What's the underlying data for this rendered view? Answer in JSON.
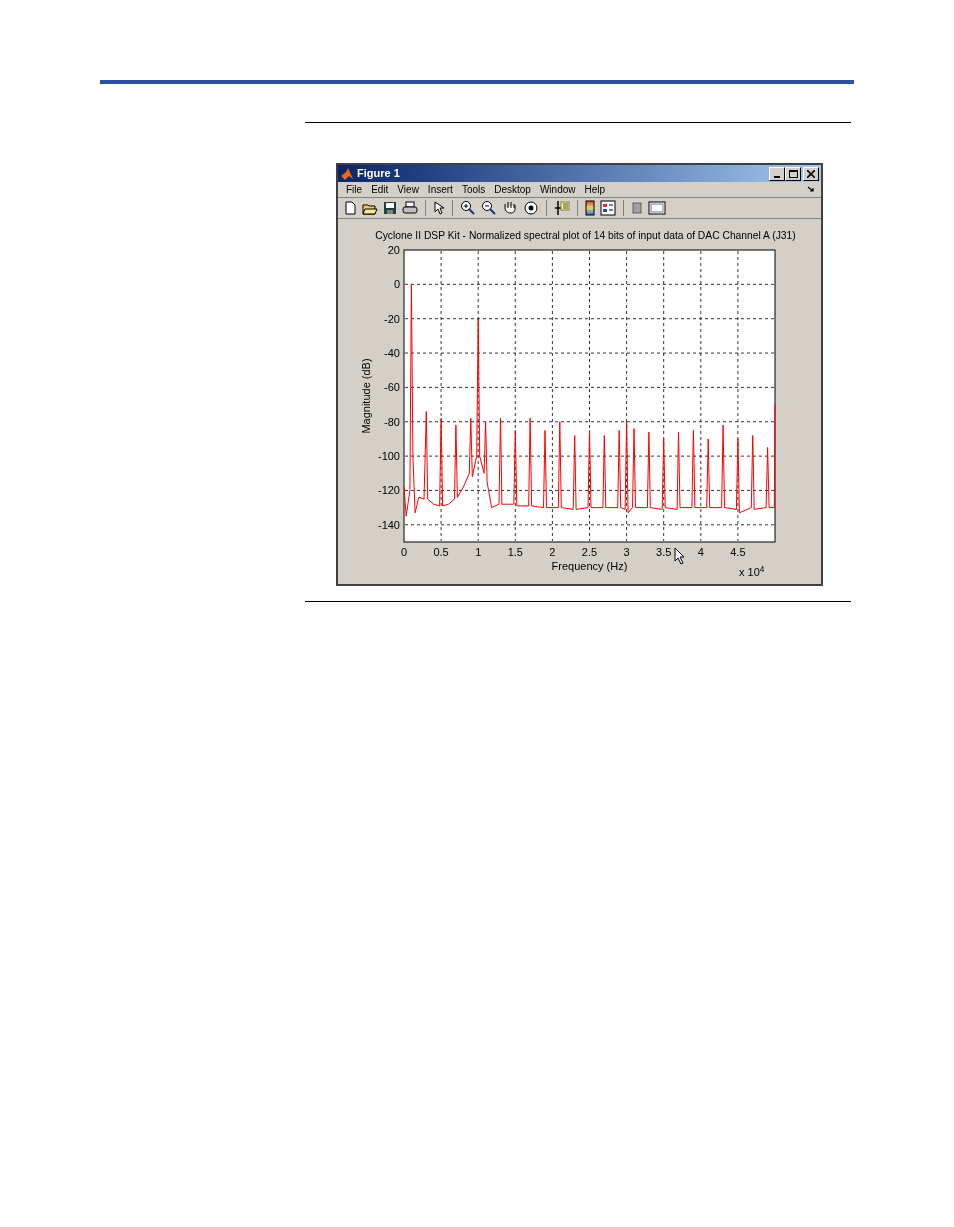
{
  "window": {
    "title": "Figure 1"
  },
  "menu": [
    "File",
    "Edit",
    "View",
    "Insert",
    "Tools",
    "Desktop",
    "Window",
    "Help"
  ],
  "figure": {
    "chart_data": {
      "type": "line",
      "title": "Cyclone II DSP Kit - Normalized spectral plot of 14 bits of input data of DAC Channel A (J31)",
      "xlabel": "Frequency (Hz)",
      "ylabel": "Magnitude (dB)",
      "x": [
        0,
        0.03,
        0.08,
        0.1,
        0.12,
        0.15,
        0.2,
        0.27,
        0.3,
        0.32,
        0.4,
        0.48,
        0.5,
        0.52,
        0.6,
        0.68,
        0.7,
        0.72,
        0.8,
        0.88,
        0.9,
        0.92,
        0.98,
        1.0,
        1.02,
        1.08,
        1.1,
        1.12,
        1.18,
        1.28,
        1.3,
        1.32,
        1.48,
        1.5,
        1.52,
        1.68,
        1.7,
        1.72,
        1.88,
        1.9,
        1.92,
        2.08,
        2.1,
        2.12,
        2.28,
        2.3,
        2.32,
        2.48,
        2.5,
        2.52,
        2.68,
        2.7,
        2.72,
        2.88,
        2.9,
        2.92,
        2.98,
        3.0,
        3.02,
        3.08,
        3.1,
        3.12,
        3.28,
        3.3,
        3.32,
        3.48,
        3.5,
        3.52,
        3.68,
        3.7,
        3.72,
        3.88,
        3.9,
        3.92,
        4.08,
        4.1,
        4.12,
        4.28,
        4.3,
        4.32,
        4.48,
        4.5,
        4.52,
        4.68,
        4.7,
        4.72,
        4.88,
        4.9,
        4.92,
        4.99,
        5.0
      ],
      "grid": true,
      "series": [
        {
          "color": "#ff0000",
          "values": [
            -118,
            -135,
            -120,
            0,
            -100,
            -133,
            -124,
            -125,
            -74,
            -125,
            -128,
            -129,
            -78,
            -129,
            -128,
            -125,
            -82,
            -124,
            -118,
            -110,
            -78,
            -112,
            -100,
            -20,
            -100,
            -110,
            -80,
            -115,
            -130,
            -128,
            -78,
            -128,
            -128,
            -85,
            -129,
            -129,
            -78,
            -129,
            -130,
            -85,
            -130,
            -130,
            -80,
            -130,
            -131,
            -88,
            -131,
            -130,
            -85,
            -130,
            -130,
            -88,
            -130,
            -130,
            -85,
            -130,
            -131,
            -80,
            -133,
            -130,
            -84,
            -130,
            -130,
            -86,
            -130,
            -131,
            -90,
            -130,
            -131,
            -86,
            -130,
            -130,
            -85,
            -130,
            -130,
            -90,
            -130,
            -130,
            -82,
            -130,
            -131,
            -90,
            -133,
            -130,
            -88,
            -131,
            -130,
            -95,
            -130,
            -130,
            -70
          ]
        }
      ],
      "xlim": [
        0,
        5
      ],
      "ylim": [
        -150,
        20
      ],
      "xticks": [
        {
          "value": 0,
          "label": "0"
        },
        {
          "value": 0.5,
          "label": "0.5"
        },
        {
          "value": 1,
          "label": "1"
        },
        {
          "value": 1.5,
          "label": "1.5"
        },
        {
          "value": 2,
          "label": "2"
        },
        {
          "value": 2.5,
          "label": "2.5"
        },
        {
          "value": 3,
          "label": "3"
        },
        {
          "value": 3.5,
          "label": "3.5"
        },
        {
          "value": 4,
          "label": "4"
        },
        {
          "value": 4.5,
          "label": "4.5"
        }
      ],
      "yticks": [
        20,
        0,
        -20,
        -40,
        -60,
        -80,
        -100,
        -120,
        -140
      ]
    },
    "x_multiplier": "x 10$^{4}$"
  }
}
